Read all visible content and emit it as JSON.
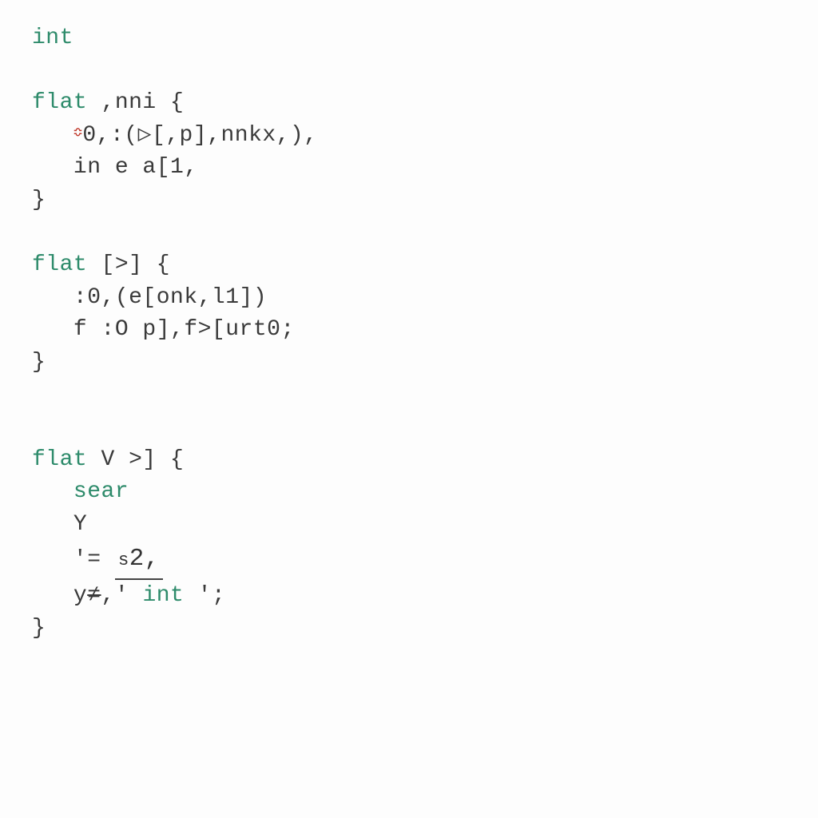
{
  "l1_kw": "int",
  "l3_kw": "flat",
  "l3_rest": " ,nni {",
  "l4_indent": "   ",
  "l4_red": "≎",
  "l4_a": "0,:(",
  "l4_tri": "▷",
  "l4_b": "[,p],nnkx,),",
  "l5": "   in e a[1,",
  "l6": "}",
  "l8_kw": "flat",
  "l8_rest": " [>] {",
  "l9": "   :0,(e[onk,l1])",
  "l10": "   f :O p],f>[urt0;",
  "l11": "}",
  "l14_kw": "flat",
  "l14_rest": " V >] {",
  "l15_kw": "   sear",
  "l16": "   Y",
  "l17_a": "   '= ",
  "l17_s": "s",
  "l17_b": "2,",
  "l18_a": "   y",
  "l18_strike": "≠",
  "l18_b": ",'",
  "l18_kw": " int ",
  "l18_c": "';",
  "l19": "}"
}
